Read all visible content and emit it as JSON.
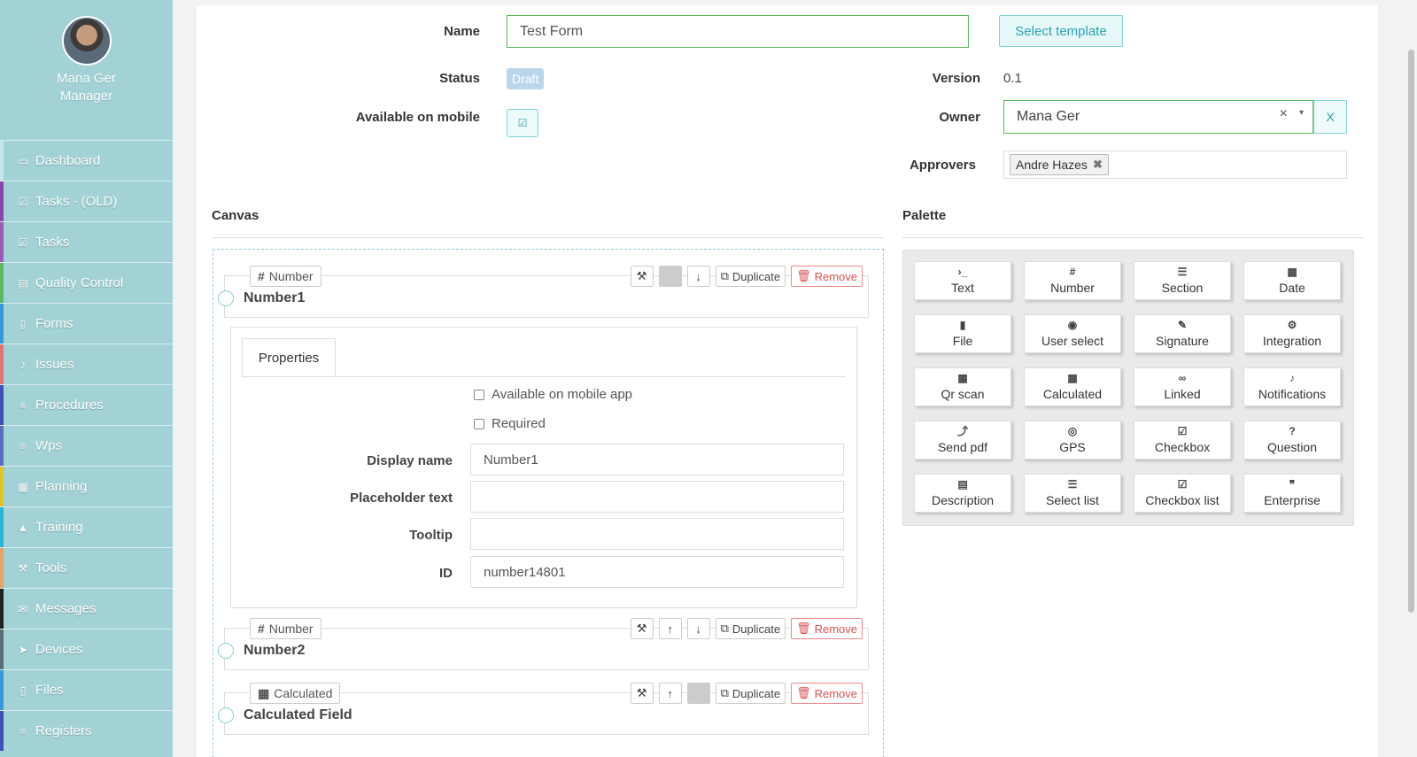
{
  "user": {
    "name": "Mana Ger",
    "role": "Manager"
  },
  "nav": [
    {
      "label": "Dashboard",
      "icon": "monitor-icon",
      "glyph": "▭",
      "color": "#c8e6e9"
    },
    {
      "label": "Tasks - (OLD)",
      "icon": "check-square-icon",
      "glyph": "☑",
      "color": "#8e44ad"
    },
    {
      "label": "Tasks",
      "icon": "check-square-icon",
      "glyph": "☑",
      "color": "#9b59b6"
    },
    {
      "label": "Quality Control",
      "icon": "book-icon",
      "glyph": "▤",
      "color": "#5cb85c"
    },
    {
      "label": "Forms",
      "icon": "file-icon",
      "glyph": "▯",
      "color": "#3498db"
    },
    {
      "label": "Issues",
      "icon": "bell-icon",
      "glyph": "♪",
      "color": "#e57373"
    },
    {
      "label": "Procedures",
      "icon": "list-icon",
      "glyph": "≡",
      "color": "#3f51b5"
    },
    {
      "label": "Wps",
      "icon": "list-icon",
      "glyph": "≡",
      "color": "#5c6bc0"
    },
    {
      "label": "Planning",
      "icon": "calendar-icon",
      "glyph": "▦",
      "color": "#e6c229"
    },
    {
      "label": "Training",
      "icon": "graduation-cap-icon",
      "glyph": "▲",
      "color": "#29b6d6"
    },
    {
      "label": "Tools",
      "icon": "wrench-icon",
      "glyph": "⚒",
      "color": "#e6a46b"
    },
    {
      "label": "Messages",
      "icon": "envelope-icon",
      "glyph": "✉",
      "color": "#222222"
    },
    {
      "label": "Devices",
      "icon": "rocket-icon",
      "glyph": "➤",
      "color": "#5a6e7a"
    },
    {
      "label": "Files",
      "icon": "file-pdf-icon",
      "glyph": "▯",
      "color": "#3498db"
    },
    {
      "label": "Registers",
      "icon": "list-icon",
      "glyph": "≡",
      "color": "#3f51b5"
    }
  ],
  "form": {
    "name_label": "Name",
    "name_value": "Test Form",
    "select_template": "Select template",
    "status_label": "Status",
    "status_value": "Draft",
    "mobile_label": "Available on mobile",
    "version_label": "Version",
    "version_value": "0.1",
    "owner_label": "Owner",
    "owner_value": "Mana Ger",
    "owner_clear_x": "×",
    "owner_caret": "▾",
    "owner_clear_button": "X",
    "approvers_label": "Approvers",
    "approvers": [
      "Andre Hazes"
    ],
    "approver_remove": "✖"
  },
  "canvas": {
    "title": "Canvas",
    "duplicate": "Duplicate",
    "remove": "Remove",
    "fields": [
      {
        "type": "Number",
        "type_icon": "#",
        "name": "Number1"
      },
      {
        "type": "Number",
        "type_icon": "#",
        "name": "Number2"
      },
      {
        "type": "Calculated",
        "type_icon": "▦",
        "name": "Calculated Field"
      }
    ],
    "properties": {
      "tab": "Properties",
      "available_mobile_app": "Available on mobile app",
      "required": "Required",
      "display_name_label": "Display name",
      "display_name_value": "Number1",
      "placeholder_label": "Placeholder text",
      "placeholder_value": "",
      "tooltip_label": "Tooltip",
      "tooltip_value": "",
      "id_label": "ID",
      "id_value": "number14801"
    }
  },
  "palette": {
    "title": "Palette",
    "items": [
      {
        "label": "Text",
        "glyph": "›_",
        "icon": "terminal-icon"
      },
      {
        "label": "Number",
        "glyph": "#",
        "icon": "hash-icon"
      },
      {
        "label": "Section",
        "glyph": "☰",
        "icon": "section-icon"
      },
      {
        "label": "Date",
        "glyph": "▦",
        "icon": "calendar-icon"
      },
      {
        "label": "File",
        "glyph": "▮",
        "icon": "file-icon"
      },
      {
        "label": "User select",
        "glyph": "◉",
        "icon": "user-circle-icon"
      },
      {
        "label": "Signature",
        "glyph": "✎",
        "icon": "signature-icon"
      },
      {
        "label": "Integration",
        "glyph": "⚙",
        "icon": "cogs-icon"
      },
      {
        "label": "Qr scan",
        "glyph": "▩",
        "icon": "qrcode-icon"
      },
      {
        "label": "Calculated",
        "glyph": "▦",
        "icon": "calculator-icon"
      },
      {
        "label": "Linked",
        "glyph": "∞",
        "icon": "link-icon"
      },
      {
        "label": "Notifications",
        "glyph": "♪",
        "icon": "bell-icon"
      },
      {
        "label": "Send pdf",
        "glyph": "⤴",
        "icon": "share-icon"
      },
      {
        "label": "GPS",
        "glyph": "◎",
        "icon": "compass-icon"
      },
      {
        "label": "Checkbox",
        "glyph": "☑",
        "icon": "check-square-icon"
      },
      {
        "label": "Question",
        "glyph": "?",
        "icon": "question-circle-icon"
      },
      {
        "label": "Description",
        "glyph": "▤",
        "icon": "file-text-icon"
      },
      {
        "label": "Select list",
        "glyph": "☰",
        "icon": "list-ol-icon"
      },
      {
        "label": "Checkbox list",
        "glyph": "☑",
        "icon": "check-square-icon"
      },
      {
        "label": "Enterprise",
        "glyph": "❞",
        "icon": "quote-icon"
      }
    ]
  }
}
